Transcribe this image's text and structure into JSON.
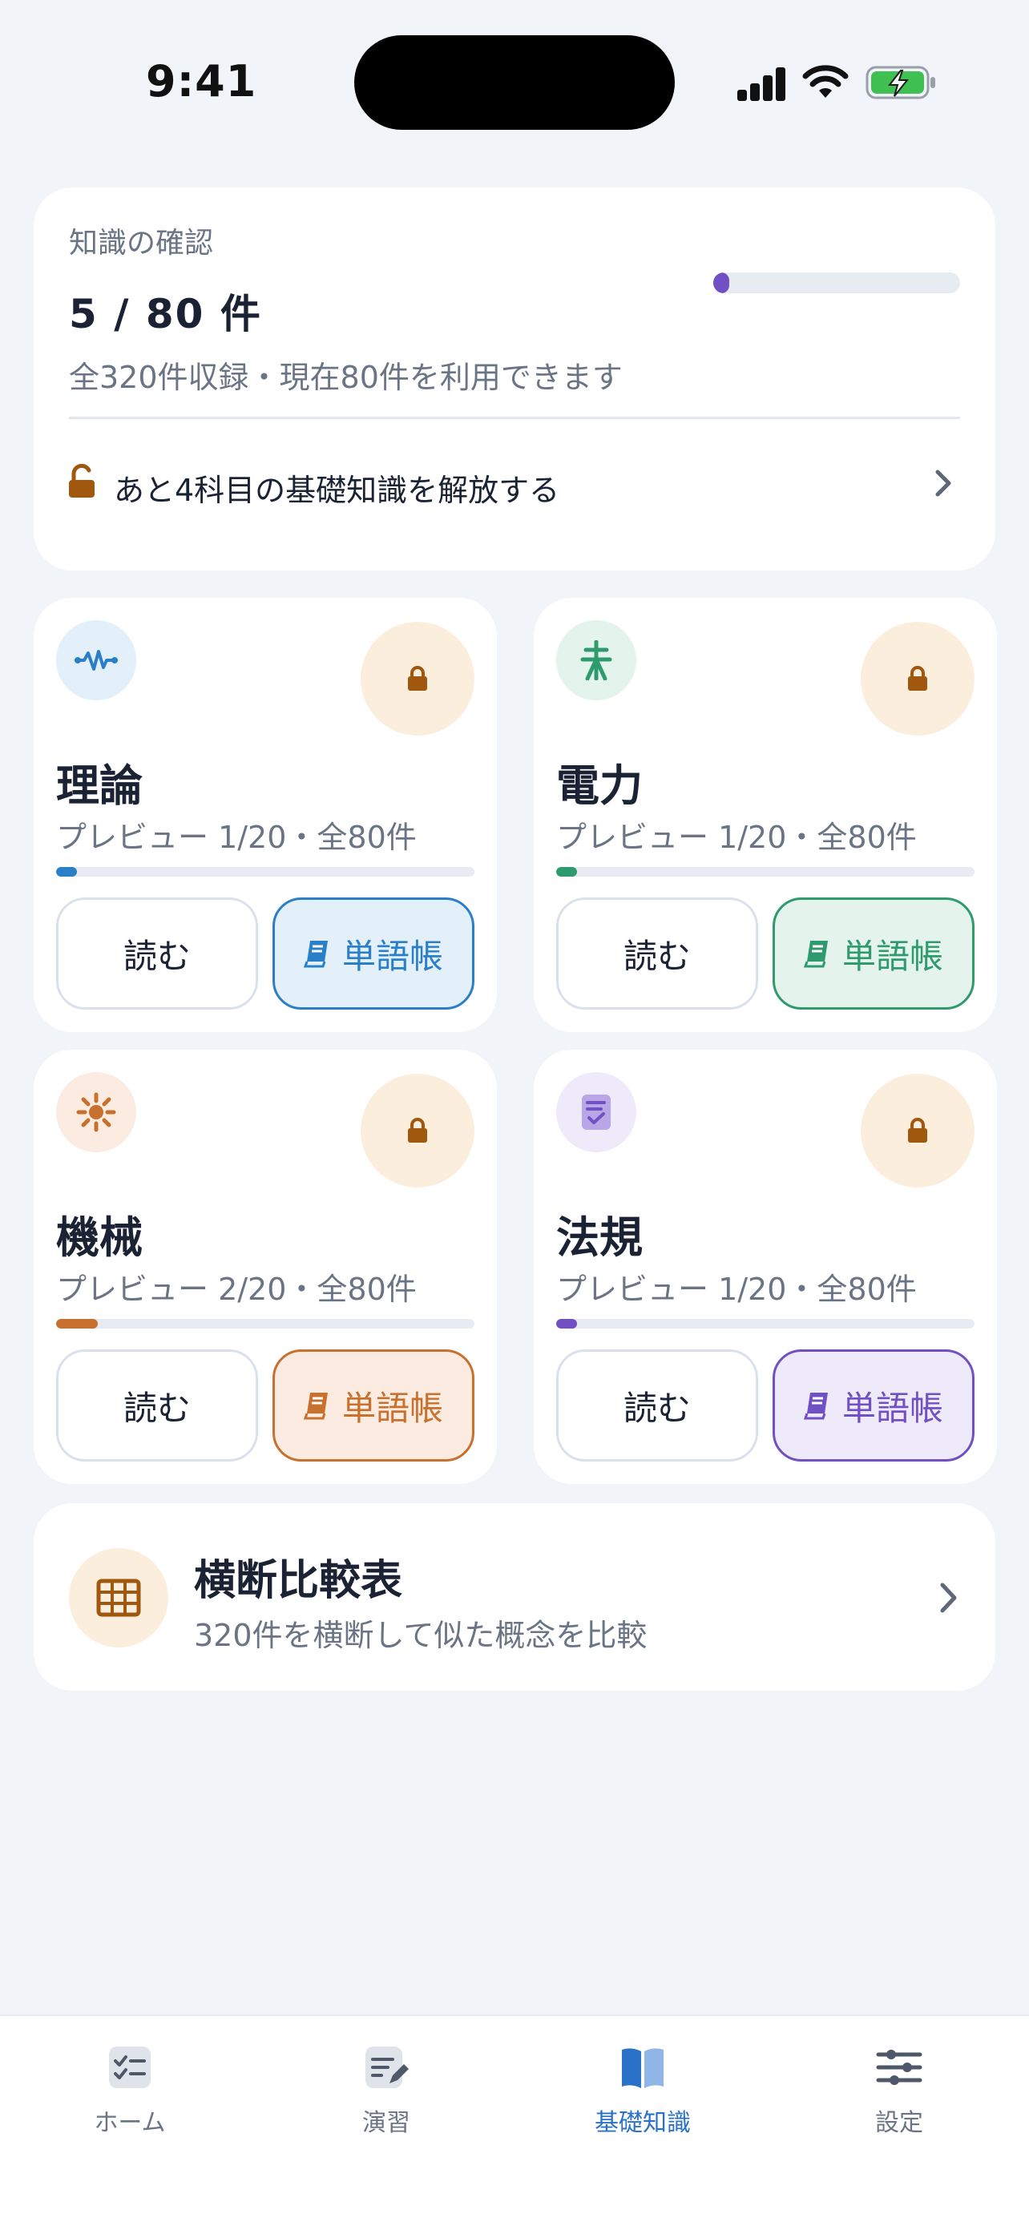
{
  "status_bar": {
    "time": "9:41"
  },
  "summary": {
    "label": "知識の確認",
    "count": "5 / 80 件",
    "progress": 0.0625,
    "sub": "全320件収録・現在80件を利用できます",
    "unlock_text": "あと4科目の基礎知識を解放する",
    "accent": "#7150c4"
  },
  "subjects": [
    {
      "title": "理論",
      "preview": "プレビュー 1/20・全80件",
      "progress": 0.05,
      "read_label": "読む",
      "vocab_label": "単語帳",
      "color": "#2a7fc8",
      "tint": "#e3f0fa",
      "icon": "waveform-icon"
    },
    {
      "title": "電力",
      "preview": "プレビュー 1/20・全80件",
      "progress": 0.05,
      "read_label": "読む",
      "vocab_label": "単語帳",
      "color": "#2e9a6e",
      "tint": "#e4f4ed",
      "icon": "power-tower-icon"
    },
    {
      "title": "機械",
      "preview": "プレビュー 2/20・全80件",
      "progress": 0.1,
      "read_label": "読む",
      "vocab_label": "単語帳",
      "color": "#c8702e",
      "tint": "#fbebe0",
      "icon": "gear-sun-icon"
    },
    {
      "title": "法規",
      "preview": "プレビュー 1/20・全80件",
      "progress": 0.05,
      "read_label": "読む",
      "vocab_label": "単語帳",
      "color": "#7150c4",
      "tint": "#efeaf9",
      "icon": "checklist-icon"
    }
  ],
  "compare": {
    "title": "横断比較表",
    "sub": "320件を横断して似た概念を比較",
    "icon": "table-icon"
  },
  "tabs": [
    {
      "label": "ホーム",
      "icon": "checklist-tab-icon",
      "active": false
    },
    {
      "label": "演習",
      "icon": "edit-tab-icon",
      "active": false
    },
    {
      "label": "基礎知識",
      "icon": "book-tab-icon",
      "active": true
    },
    {
      "label": "設定",
      "icon": "sliders-tab-icon",
      "active": false
    }
  ]
}
